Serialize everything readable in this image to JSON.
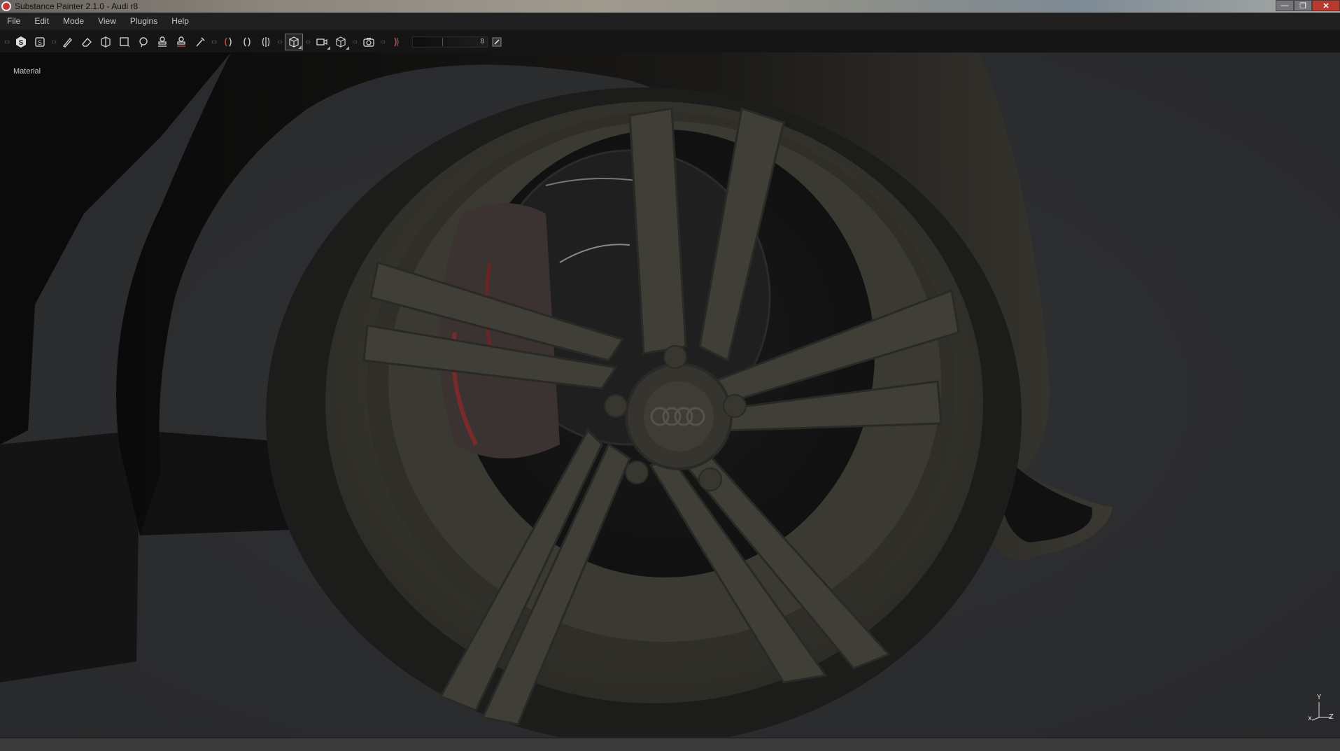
{
  "window": {
    "title": "Substance Painter 2.1.0 - Audi r8",
    "controls": [
      "minimize",
      "maximize",
      "close"
    ]
  },
  "menu": {
    "items": [
      "File",
      "Edit",
      "Mode",
      "View",
      "Plugins",
      "Help"
    ]
  },
  "toolbar": {
    "tools": [
      "substance-logo-icon",
      "bake-icon",
      "paint-brush-icon",
      "eraser-icon",
      "projection-icon",
      "polygon-fill-icon",
      "smudge-icon",
      "clone-icon",
      "stamp-icon",
      "color-picker-icon",
      "symmetry-icon",
      "mirror-icon",
      "mirror-axis-icon",
      "cube-view-icon",
      "camera-icon",
      "camera-orbit-icon",
      "screenshot-icon",
      "parenthesis-icon"
    ],
    "slider_value": "8"
  },
  "viewport": {
    "label": "Material",
    "logo_text": "",
    "axis": {
      "x": "x",
      "y": "Y",
      "z": "Z"
    }
  }
}
